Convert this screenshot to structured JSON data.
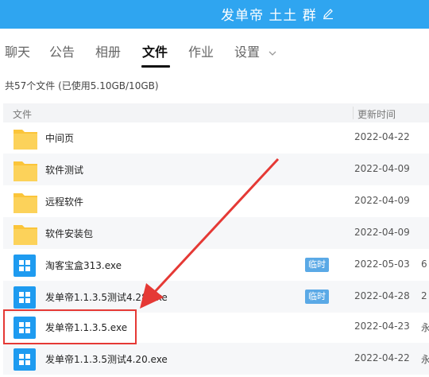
{
  "header": {
    "title": "发单帝 土土 群",
    "edit_icon": "edit-pencil-icon",
    "bg_color": "#2fa5f0"
  },
  "tabs": [
    {
      "label": "聊天"
    },
    {
      "label": "公告"
    },
    {
      "label": "相册"
    },
    {
      "label": "文件",
      "active": true
    },
    {
      "label": "作业"
    },
    {
      "label": "设置"
    }
  ],
  "summary": "共57个文件 (已使用5.10GB/10GB)",
  "table": {
    "col_name": "文件",
    "col_time": "更新时间",
    "rows": [
      {
        "type": "folder",
        "name": "中间页",
        "date": "2022-04-22",
        "badge": "",
        "extra": ""
      },
      {
        "type": "folder",
        "name": "软件测试",
        "date": "2022-04-09",
        "badge": "",
        "extra": ""
      },
      {
        "type": "folder",
        "name": "远程软件",
        "date": "2022-04-09",
        "badge": "",
        "extra": ""
      },
      {
        "type": "folder",
        "name": "软件安装包",
        "date": "2022-04-09",
        "badge": "",
        "extra": ""
      },
      {
        "type": "exe",
        "name": "淘客宝盒313.exe",
        "date": "2022-05-03",
        "badge": "临时",
        "extra": "6"
      },
      {
        "type": "exe",
        "name": "发单帝1.1.3.5测试4.28.exe",
        "date": "2022-04-28",
        "badge": "临时",
        "extra": "2"
      },
      {
        "type": "exe",
        "name": "发单帝1.1.3.5.exe",
        "date": "2022-04-23",
        "badge": "",
        "extra": "永"
      },
      {
        "type": "exe",
        "name": "发单帝1.1.3.5测试4.20.exe",
        "date": "2022-04-22",
        "badge": "",
        "extra": "永"
      }
    ]
  },
  "colors": {
    "folder": "#fbc53a",
    "exe": "#1e9bf0",
    "badge": "#5aa9e6",
    "highlight": "#e53935"
  }
}
